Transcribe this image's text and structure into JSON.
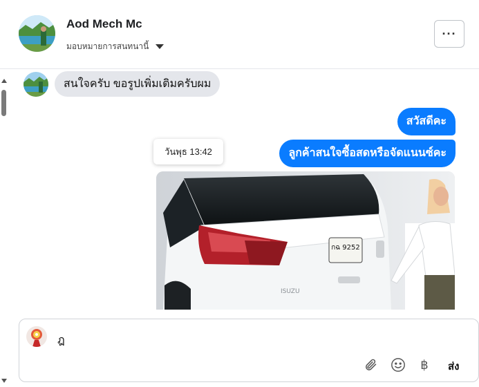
{
  "header": {
    "contact_name": "Aod Mech Mc",
    "assign_label": "มอบหมายการสนทนานี้",
    "more_label": "···"
  },
  "messages": {
    "incoming_1": "สนใจครับ ขอรูปเพิ่มเติมครับผม",
    "outgoing_1": "สวัสดีคะ",
    "outgoing_2": "ลูกค้าสนใจซื้อสดหรือจัดแนนซ์คะ",
    "timestamp": "วันพุธ 13:42",
    "photo_plate": "กฉ 9252",
    "photo_badge": "ISUZU"
  },
  "composer": {
    "input_value": "ฎ",
    "send_label": "ส่ง",
    "baht_symbol": "฿"
  },
  "colors": {
    "outgoing_bubble": "#0a7cff",
    "incoming_bubble": "#e4e6eb"
  }
}
